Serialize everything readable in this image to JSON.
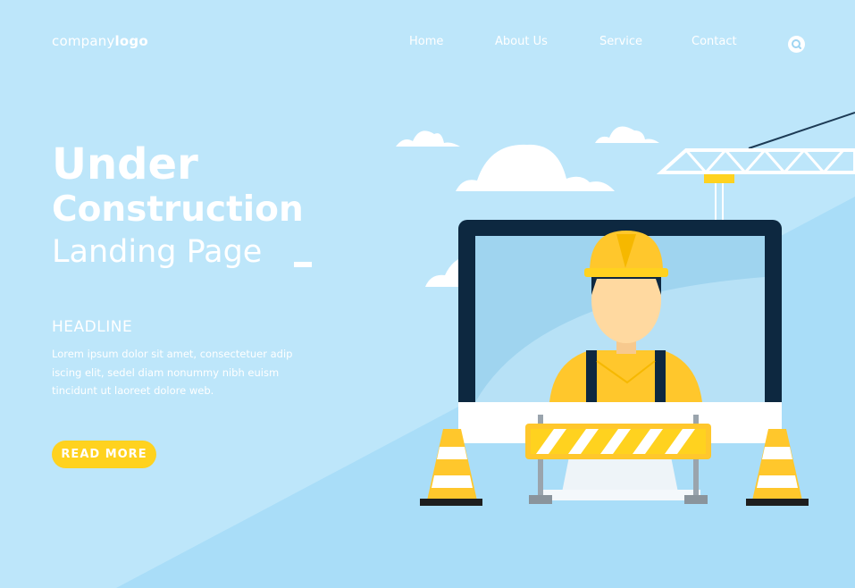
{
  "header": {
    "logo_light": "company",
    "logo_bold": "logo",
    "nav": [
      {
        "label": "Home"
      },
      {
        "label": "About Us"
      },
      {
        "label": "Service"
      },
      {
        "label": "Contact"
      }
    ],
    "search_icon": "search-icon"
  },
  "hero": {
    "title_line1": "Under",
    "title_line2": "Construction",
    "title_line3": "Landing Page",
    "headline": "HEADLINE",
    "body": "Lorem ipsum dolor sit amet, consectetuer adip iscing elit, sedel diam nonummy nibh euism tincidunt ut laoreet dolore web.",
    "cta_label": "READ MORE"
  },
  "colors": {
    "background": "#bde6fa",
    "background_diagonal": "#a6dcf8",
    "accent_yellow": "#ffd21f",
    "monitor_frame": "#0d2840",
    "text": "#ffffff"
  },
  "illustration": {
    "icons": [
      "cloud-icon",
      "crane-icon",
      "monitor-icon",
      "construction-worker-icon",
      "road-barrier-icon",
      "traffic-cone-icon"
    ]
  }
}
